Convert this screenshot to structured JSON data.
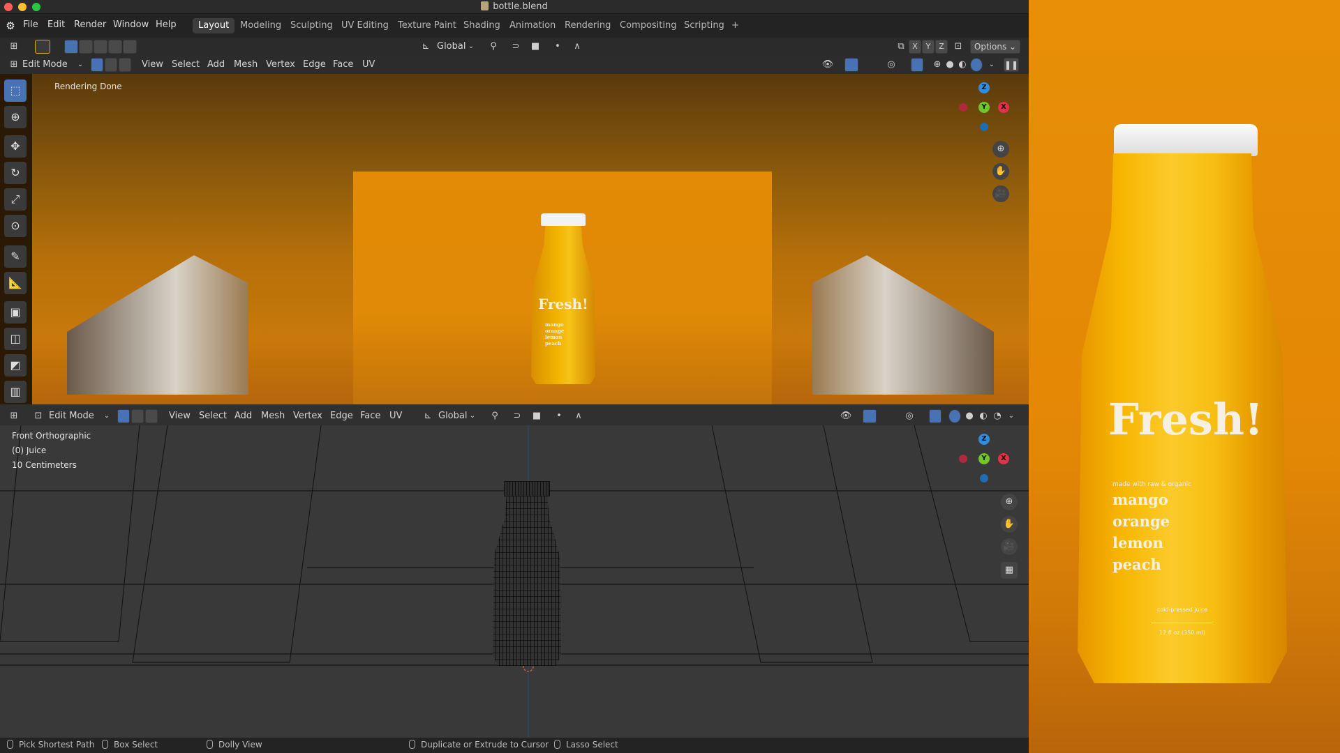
{
  "window": {
    "title": "bottle.blend"
  },
  "menu": [
    "File",
    "Edit",
    "Render",
    "Window",
    "Help"
  ],
  "workspaces": [
    "Layout",
    "Modeling",
    "Sculpting",
    "UV Editing",
    "Texture Paint",
    "Shading",
    "Animation",
    "Rendering",
    "Compositing",
    "Scripting"
  ],
  "active_workspace": "Layout",
  "toolbar": {
    "orientation": "Global",
    "axes": [
      "X",
      "Y",
      "Z"
    ],
    "options": "Options"
  },
  "viewport1": {
    "mode": "Edit Mode",
    "menu": [
      "View",
      "Select",
      "Add",
      "Mesh",
      "Vertex",
      "Edge",
      "Face",
      "UV"
    ],
    "status": "Rendering Done"
  },
  "viewport2": {
    "mode": "Edit Mode",
    "menu": [
      "View",
      "Select",
      "Add",
      "Mesh",
      "Vertex",
      "Edge",
      "Face",
      "UV"
    ],
    "orientation": "Global",
    "overlay": [
      "Front Orthographic",
      "(0) Juice",
      "10 Centimeters"
    ]
  },
  "gizmo": {
    "z": "Z",
    "y": "Y",
    "x": "X"
  },
  "colors": {
    "accent": "#4772b3",
    "x_axis": "#e0324a",
    "y_axis": "#6fc72b",
    "z_axis": "#2e8fe0"
  },
  "statusbar": [
    "Pick Shortest Path",
    "Box Select",
    "Dolly View",
    "Duplicate or Extrude to Cursor",
    "Lasso Select"
  ],
  "render": {
    "headline": "Fresh!",
    "subline": "made with raw & organic",
    "flavors": [
      "mango",
      "orange",
      "lemon",
      "peach"
    ],
    "tagline": "cold-pressed juice",
    "volume": "12 fl oz (350 ml)"
  }
}
